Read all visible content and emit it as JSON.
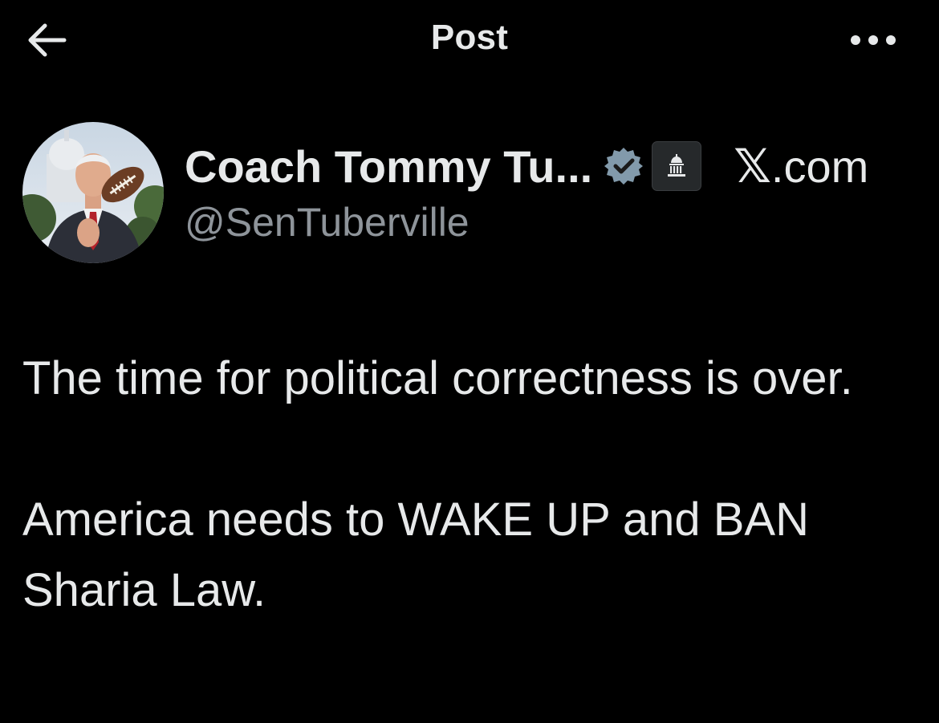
{
  "topbar": {
    "back_icon": "arrow-left-icon",
    "title": "Post",
    "more_icon": "more-horizontal-icon"
  },
  "author": {
    "avatar_icon": "profile-photo",
    "display_name": "Coach Tommy Tu...",
    "verified_icon": "verified-badge-icon",
    "verified_color": "#829aab",
    "affiliation_icon": "government-building-icon",
    "handle": "@SenTuberville",
    "source_label": ".com",
    "source_icon": "x-logo"
  },
  "post": {
    "paragraphs": [
      "The time for political correctness is over.",
      "America needs to WAKE UP and BAN Sharia Law."
    ]
  },
  "colors": {
    "background": "#000000",
    "text_primary": "#e7e9ea",
    "text_secondary": "#8e949a"
  }
}
